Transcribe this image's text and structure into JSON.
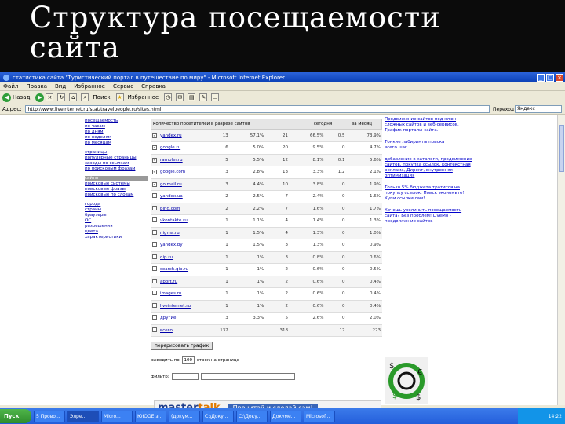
{
  "slide": {
    "title_line1": "Структура посещаемости",
    "title_line2": "сайта"
  },
  "window": {
    "title": "статистика сайта \"Туристический портал в путешествие по миру\" - Microsoft Internet Explorer",
    "minimize": "_",
    "maximize": "□",
    "close": "×"
  },
  "menu": [
    "Файл",
    "Правка",
    "Вид",
    "Избранное",
    "Сервис",
    "Справка"
  ],
  "toolbar": {
    "back": "Назад",
    "search": "Поиск",
    "favorites": "Избранное"
  },
  "address": {
    "label": "Адрес:",
    "url": "http://www.liveinternet.ru/stat/travelpeople.ru/sites.html",
    "go": "Переход",
    "yandex": "Яндекс"
  },
  "stats": {
    "header_text": "количество посетителей в разрезе сайтов",
    "col_today": "сегодня",
    "col_month": "за месяц",
    "rows": [
      {
        "name": "yandex.ru",
        "checked": true,
        "v1": "13",
        "v2": "57.1%",
        "v3": "21",
        "v4": "66.5%",
        "v5": "0.5",
        "v6": "73.9%"
      },
      {
        "name": "google.ru",
        "checked": true,
        "v1": "6",
        "v2": "5.0%",
        "v3": "20",
        "v4": "9.5%",
        "v5": "0",
        "v6": "4.7%"
      },
      {
        "name": "rambler.ru",
        "checked": true,
        "v1": "5",
        "v2": "5.5%",
        "v3": "12",
        "v4": "8.1%",
        "v5": "0.1",
        "v6": "5.6%"
      },
      {
        "name": "google.com",
        "checked": true,
        "v1": "3",
        "v2": "2.8%",
        "v3": "13",
        "v4": "3.3%",
        "v5": "1.2",
        "v6": "2.1%"
      },
      {
        "name": "go.mail.ru",
        "checked": true,
        "v1": "3",
        "v2": "4.4%",
        "v3": "10",
        "v4": "3.8%",
        "v5": "0",
        "v6": "1.9%"
      },
      {
        "name": "yandex.ua",
        "checked": false,
        "v1": "2",
        "v2": "2.5%",
        "v3": "7",
        "v4": "2.4%",
        "v5": "0",
        "v6": "1.6%"
      },
      {
        "name": "bing.com",
        "checked": false,
        "v1": "2",
        "v2": "2.2%",
        "v3": "7",
        "v4": "1.6%",
        "v5": "0",
        "v6": "1.7%"
      },
      {
        "name": "vkontakte.ru",
        "checked": false,
        "v1": "1",
        "v2": "1.1%",
        "v3": "4",
        "v4": "1.4%",
        "v5": "0",
        "v6": "1.3%"
      },
      {
        "name": "nigma.ru",
        "checked": false,
        "v1": "1",
        "v2": "1.5%",
        "v3": "4",
        "v4": "1.3%",
        "v5": "0",
        "v6": "1.0%"
      },
      {
        "name": "yandex.by",
        "checked": false,
        "v1": "1",
        "v2": "1.5%",
        "v3": "3",
        "v4": "1.3%",
        "v5": "0",
        "v6": "0.9%"
      },
      {
        "name": "qip.ru",
        "checked": false,
        "v1": "1",
        "v2": "1%",
        "v3": "3",
        "v4": "0.8%",
        "v5": "0",
        "v6": "0.6%"
      },
      {
        "name": "search.qip.ru",
        "checked": false,
        "v1": "1",
        "v2": "1%",
        "v3": "2",
        "v4": "0.6%",
        "v5": "0",
        "v6": "0.5%"
      },
      {
        "name": "aport.ru",
        "checked": false,
        "v1": "1",
        "v2": "1%",
        "v3": "2",
        "v4": "0.6%",
        "v5": "0",
        "v6": "0.4%"
      },
      {
        "name": "images.ru",
        "checked": false,
        "v1": "1",
        "v2": "1%",
        "v3": "2",
        "v4": "0.6%",
        "v5": "0",
        "v6": "0.4%"
      },
      {
        "name": "liveinternet.ru",
        "checked": false,
        "v1": "1",
        "v2": "1%",
        "v3": "2",
        "v4": "0.6%",
        "v5": "0",
        "v6": "0.4%"
      },
      {
        "name": "другие",
        "checked": false,
        "v1": "3",
        "v2": "3.3%",
        "v3": "5",
        "v4": "2.6%",
        "v5": "0",
        "v6": "2.0%"
      },
      {
        "name": "всего",
        "checked": false,
        "v1": "132",
        "v2": "",
        "v3": "318",
        "v4": "",
        "v5": "17",
        "v6": "223"
      }
    ],
    "redraw_button": "перерисовать график",
    "perpage_label": "выводить по",
    "perpage_value": "100",
    "perpage_suffix": "строк на странице",
    "filter_label": "фильтр:"
  },
  "leftnav": {
    "items": [
      "посещаемость",
      "по часам",
      "по дням",
      "по неделям",
      "по месяцам",
      "страницы",
      "популярные страницы",
      "заходы по ссылкам",
      "по поисковым фразам",
      "сайты",
      "поисковые системы",
      "поисковые фразы",
      "поисковые по словам",
      "города",
      "страны",
      "браузеры",
      "ОС",
      "разрешения",
      "цвета",
      "характеристики"
    ],
    "highlighted_index": 9
  },
  "ads": [
    {
      "title": "Продвижение сайтов под ключ",
      "text": "сложных сайтов и веб-сервисов. Трафик порталы сайта."
    },
    {
      "title": "Тонкие лабиринты поиска",
      "text": "всего шаг."
    },
    {
      "title": "Только 5% бюджета тратится на",
      "text": "покупку ссылок. Поиск экономьте! Купи ссылки сам!"
    },
    {
      "title": "Хочешь увеличить посещаемость",
      "text": "сайта? Без проблем! LiveMo - продвижение сайтов"
    }
  ],
  "ads_mid": "добавление в каталоги, продвижение сайтов, покупка ссылок, контекстная реклама, Директ, внутренняя оптимизация",
  "banner": {
    "logo_a": "master",
    "logo_b": "talk",
    "tagline": "Прочитай и сделай сам!"
  },
  "taskbar": {
    "start": "Пуск",
    "tasks": [
      "5 Прово...",
      "Элре...",
      "Micro...",
      "ЮЮОЕ з...",
      "(докум...",
      "C:\\Доку...",
      "C:\\Доку...",
      "Докуме...",
      "Microsof..."
    ],
    "active_index": 1,
    "clock": "14:22"
  }
}
